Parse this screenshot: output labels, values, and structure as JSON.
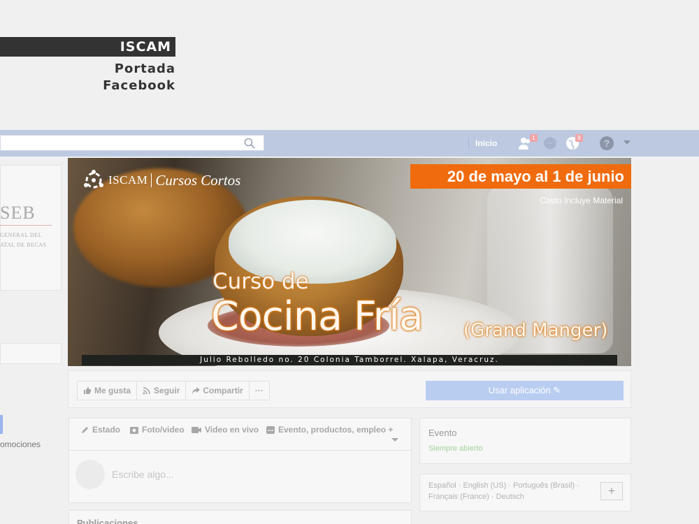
{
  "caption": {
    "tag": "ISCAM",
    "line1": "Portada",
    "line2": "Facebook"
  },
  "topbar": {
    "home": "Inicio",
    "friends_badge": "1",
    "notif_badge": "8"
  },
  "left": {
    "seb": "SEB",
    "line1": "GENERAL DEL",
    "line2": "ATAL DE BECAS",
    "promo": "omociones"
  },
  "cover": {
    "logo_iscam": "ISCAM",
    "logo_cursos": "Cursos Cortos",
    "date": "20 de mayo al 1 de junio",
    "costo": "Costo Incluye Material",
    "curso_de": "Curso de",
    "cocina": "Cocina Fría",
    "grand": "(Grand Manger)",
    "address": "Julio Rebolledo no. 20 Colonia Tamborrel. Xalapa, Veracruz."
  },
  "actions": {
    "like": "Me gusta",
    "follow": "Seguir",
    "share": "Compartir",
    "more": "···",
    "use_app": "Usar aplicación"
  },
  "composer": {
    "estado": "Estado",
    "foto": "Foto/video",
    "video": "Video en vivo",
    "evento": "Evento, productos, empleo +",
    "placeholder": "Escribe algo..."
  },
  "publicaciones": "Publicaciones",
  "evento": {
    "title": "Evento",
    "status": "Siempre abierto"
  },
  "languages": {
    "line1": "Español · English (US) · Português (Brasil) ·",
    "line2": "Français (France) · Deutsch",
    "plus": "+"
  },
  "colors": {
    "orange": "#f06b0d",
    "fb_bar": "#bcc9e0",
    "button_blue": "#b9cdf1",
    "green": "#a3d39c"
  }
}
